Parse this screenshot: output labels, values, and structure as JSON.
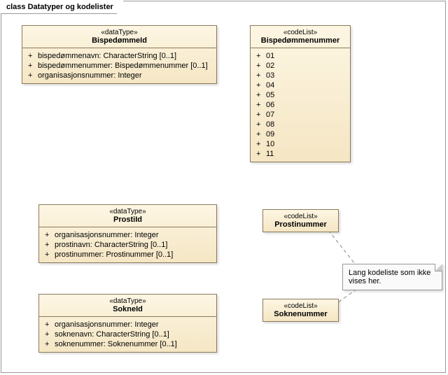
{
  "frame_title": "class Datatyper og kodelister",
  "boxes": {
    "bispedommeId": {
      "stereo": "«dataType»",
      "name": "BispedømmeId",
      "attrs": [
        "bispedømmenavn: CharacterString [0..1]",
        "bispedømmenummer: Bispedømmenummer [0..1]",
        "organisasjonsnummer: Integer"
      ]
    },
    "bispedommenummer": {
      "stereo": "«codeList»",
      "name": "Bispedømmenummer",
      "codes": [
        "01",
        "02",
        "03",
        "04",
        "05",
        "06",
        "07",
        "08",
        "09",
        "10",
        "11"
      ]
    },
    "prostiId": {
      "stereo": "«dataType»",
      "name": "ProstiId",
      "attrs": [
        "organisasjonsnummer: Integer",
        "prostinavn: CharacterString [0..1]",
        "prostinummer: Prostinummer [0..1]"
      ]
    },
    "prostinummer": {
      "stereo": "«codeList»",
      "name": "Prostinummer"
    },
    "sokneId": {
      "stereo": "«dataType»",
      "name": "SokneId",
      "attrs": [
        "organisasjonsnummer: Integer",
        "soknenavn: CharacterString [0..1]",
        "soknenummer: Soknenummer [0..1]"
      ]
    },
    "soknenummer": {
      "stereo": "«codeList»",
      "name": "Soknenummer"
    }
  },
  "note_text": "Lang kodeliste som ikke vises her."
}
